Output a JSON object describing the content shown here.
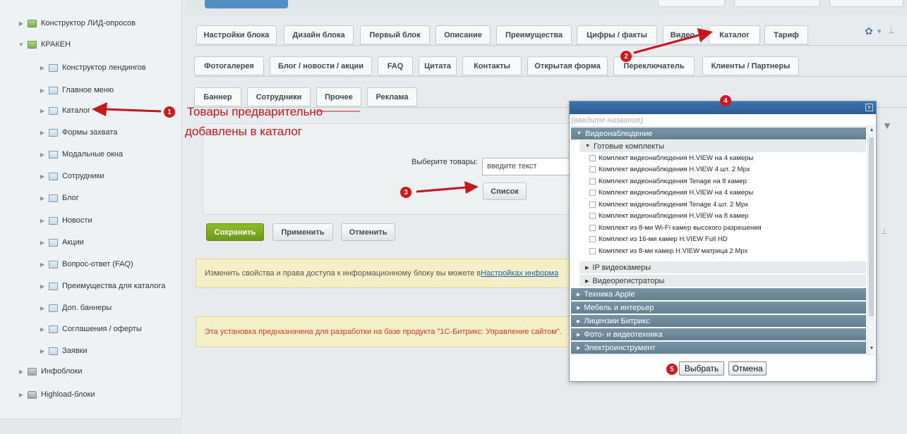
{
  "sidebar": {
    "items": [
      {
        "label": "Конструктор ЛИД-опросов",
        "arrow": "▶",
        "icon": "list-icon"
      },
      {
        "label": "КРАКЕН",
        "arrow": "▼",
        "icon": "list-icon"
      },
      {
        "label": "Конструктор лендингов",
        "arrow": "▶",
        "icon": "folder-icon"
      },
      {
        "label": "Главное меню",
        "arrow": "▶",
        "icon": "folder-icon"
      },
      {
        "label": "Каталог",
        "arrow": "▶",
        "icon": "folder-icon"
      },
      {
        "label": "Формы захвата",
        "arrow": "▶",
        "icon": "folder-icon"
      },
      {
        "label": "Модальные окна",
        "arrow": "▶",
        "icon": "folder-icon"
      },
      {
        "label": "Сотрудники",
        "arrow": "▶",
        "icon": "folder-icon"
      },
      {
        "label": "Блог",
        "arrow": "▶",
        "icon": "folder-icon"
      },
      {
        "label": "Новости",
        "arrow": "▶",
        "icon": "folder-icon"
      },
      {
        "label": "Акции",
        "arrow": "▶",
        "icon": "folder-icon"
      },
      {
        "label": "Вопрос-ответ (FAQ)",
        "arrow": "▶",
        "icon": "folder-icon"
      },
      {
        "label": "Преимущества для каталога",
        "arrow": "▶",
        "icon": "folder-icon"
      },
      {
        "label": "Доп. баннеры",
        "arrow": "▶",
        "icon": "folder-icon"
      },
      {
        "label": "Соглашения / оферты",
        "arrow": "▶",
        "icon": "folder-icon"
      },
      {
        "label": "Заявки",
        "arrow": "▶",
        "icon": "folder-icon"
      },
      {
        "label": "Инфоблоки",
        "arrow": "▶",
        "icon": "database-icon"
      },
      {
        "label": "Highload-блоки",
        "arrow": "▶",
        "icon": "database-icon"
      }
    ]
  },
  "tabs": {
    "row1": [
      "Настройки блока",
      "Дизайн блока",
      "Первый блок",
      "Описание",
      "Преимущества",
      "Цифры / факты",
      "Видео",
      "Каталог",
      "Тариф"
    ],
    "row2": [
      "Фотогалерея",
      "Блог / новости / акции",
      "FAQ",
      "Цитата",
      "Контакты",
      "Открытая форма",
      "Переключатель",
      "Клиенты / Партнеры"
    ],
    "row3": [
      "Баннер",
      "Сотрудники",
      "Прочее",
      "Реклама"
    ],
    "active_row1": "Каталог"
  },
  "form": {
    "select_label": "Выберите товары:",
    "input_value": "введите текст",
    "list_button": "Список"
  },
  "actions": {
    "save": "Сохранить",
    "apply": "Применить",
    "cancel": "Отменить"
  },
  "notices": {
    "rights_text": "Изменить свойства и права доступа к информационному блоку вы можете в ",
    "rights_link": "Настройках информа",
    "install_text": "Эта установка предназначена для разработки на базе продукта \"1С-Битрикс: Управление сайтом\"."
  },
  "dialog": {
    "search_placeholder": "(введите название)",
    "categories_open": {
      "label": "Видеонаблюдение",
      "subsection": "Готовые комплекты",
      "items": [
        "Комплект видеонаблюдения H.VIEW на 4 камеры",
        "Комплект видеонаблюдения H.VIEW 4 шт. 2 Mpx",
        "Комплект видеонаблюдения Tenage на 8 камер",
        "Комплект видеонаблюдения H.VIEW на 4 камеры",
        "Комплект видеонаблюдения Tenage 4 шт. 2 Mpx",
        "Комплект видеонаблюдения H.VIEW на 8 камер",
        "Комплект из 8-ми Wi-Fi камер высокого разрешения",
        "Комплект из 16-ми камер H.VIEW Full HD",
        "Комплект из 8-ми камер H.VIEW матрица 2 Mpx"
      ],
      "other_subsections": [
        "IP видеокамеры",
        "Видеорегистраторы"
      ]
    },
    "categories_closed": [
      "Техника Apple",
      "Мебель и интерьер",
      "Лицензии Битрикс",
      "Фото- и видеотехника",
      "Электроинструмент"
    ],
    "select_button": "Выбрать",
    "cancel_button": "Отмена"
  },
  "annotations": {
    "note_line1": "Товары предварительно",
    "note_line2": "добавлены в каталог",
    "badges": [
      "1",
      "2",
      "3",
      "4",
      "5"
    ],
    "color": "#d7141a"
  },
  "colors": {
    "accent_blue": "#2a5c92",
    "save_green": "#6a9b15",
    "category_bar": "#6e889a"
  }
}
